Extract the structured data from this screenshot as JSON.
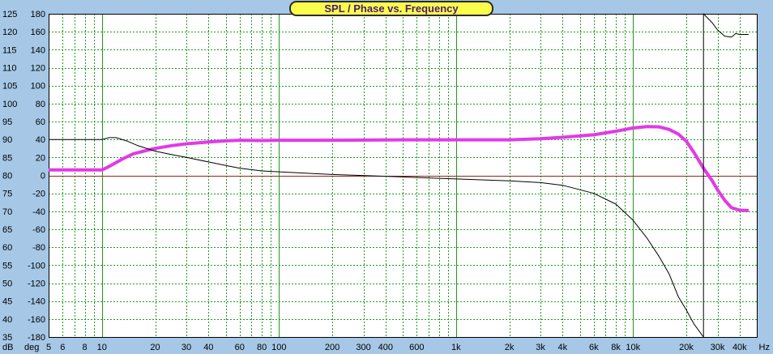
{
  "title": "SPL / Phase vs. Frequency",
  "colors": {
    "background": "#a6c8e6",
    "plot_area": "#ffffff",
    "grid": "#1f9a1f",
    "zero_line": "#8b2b1b",
    "spl_trace": "#e23ae6",
    "phase_trace": "#000000",
    "title_fill": "#fcfc4a",
    "title_text": "#4a1a7a"
  },
  "chart_data": {
    "type": "line",
    "title": "SPL / Phase vs. Frequency",
    "x_scale": "log",
    "xlim": [
      5,
      50000
    ],
    "x_unit_label": "Hz",
    "x_ticks": [
      {
        "v": 5,
        "label": "5"
      },
      {
        "v": 6,
        "label": "6"
      },
      {
        "v": 8,
        "label": "8"
      },
      {
        "v": 10,
        "label": "10"
      },
      {
        "v": 20,
        "label": "20"
      },
      {
        "v": 30,
        "label": "30"
      },
      {
        "v": 40,
        "label": "40"
      },
      {
        "v": 60,
        "label": "60"
      },
      {
        "v": 80,
        "label": "80"
      },
      {
        "v": 100,
        "label": "100"
      },
      {
        "v": 200,
        "label": "200"
      },
      {
        "v": 300,
        "label": "300"
      },
      {
        "v": 400,
        "label": "400"
      },
      {
        "v": 600,
        "label": "600"
      },
      {
        "v": 1000,
        "label": "1k"
      },
      {
        "v": 2000,
        "label": "2k"
      },
      {
        "v": 3000,
        "label": "3k"
      },
      {
        "v": 4000,
        "label": "4k"
      },
      {
        "v": 6000,
        "label": "6k"
      },
      {
        "v": 8000,
        "label": "8k"
      },
      {
        "v": 10000,
        "label": "10k"
      },
      {
        "v": 20000,
        "label": "20k"
      },
      {
        "v": 30000,
        "label": "30k"
      },
      {
        "v": 40000,
        "label": "40k"
      }
    ],
    "y_left": {
      "unit_label": "dB",
      "ylim": [
        35,
        125
      ],
      "ticks": [
        35,
        40,
        45,
        50,
        55,
        60,
        65,
        70,
        75,
        80,
        85,
        90,
        95,
        100,
        105,
        110,
        115,
        120,
        125
      ]
    },
    "y_right": {
      "unit_label": "deg",
      "ylim": [
        -180,
        180
      ],
      "ticks": [
        -180,
        -160,
        -140,
        -120,
        -100,
        -80,
        -60,
        -40,
        -20,
        0,
        20,
        40,
        60,
        80,
        100,
        120,
        140,
        160,
        180
      ]
    },
    "grid": true,
    "series": [
      {
        "axis": "left",
        "color": "#e23ae6",
        "points": [
          [
            5,
            81.5
          ],
          [
            10,
            81.5
          ],
          [
            11,
            82.5
          ],
          [
            13,
            84.5
          ],
          [
            15,
            86
          ],
          [
            18,
            87
          ],
          [
            20,
            87.5
          ],
          [
            25,
            88.3
          ],
          [
            30,
            88.8
          ],
          [
            40,
            89.3
          ],
          [
            50,
            89.6
          ],
          [
            60,
            89.8
          ],
          [
            80,
            89.7
          ],
          [
            100,
            89.8
          ],
          [
            200,
            89.8
          ],
          [
            500,
            89.9
          ],
          [
            1000,
            89.9
          ],
          [
            2000,
            89.9
          ],
          [
            3000,
            90.2
          ],
          [
            4000,
            90.6
          ],
          [
            6000,
            91.3
          ],
          [
            8000,
            92.3
          ],
          [
            10000,
            93.2
          ],
          [
            12000,
            93.6
          ],
          [
            14000,
            93.5
          ],
          [
            16000,
            92.8
          ],
          [
            18000,
            91.5
          ],
          [
            20000,
            89.5
          ],
          [
            22000,
            86.5
          ],
          [
            25000,
            82
          ],
          [
            28000,
            78.5
          ],
          [
            30000,
            76
          ],
          [
            33000,
            73
          ],
          [
            36000,
            71
          ],
          [
            40000,
            70.3
          ],
          [
            45000,
            70.2
          ]
        ]
      },
      {
        "axis": "right",
        "color": "#000000",
        "points": [
          [
            5,
            40
          ],
          [
            10,
            40
          ],
          [
            11,
            42
          ],
          [
            12,
            42
          ],
          [
            14,
            38
          ],
          [
            16,
            33
          ],
          [
            20,
            27
          ],
          [
            25,
            23
          ],
          [
            30,
            20
          ],
          [
            40,
            15
          ],
          [
            50,
            11
          ],
          [
            60,
            8
          ],
          [
            80,
            5
          ],
          [
            100,
            4
          ],
          [
            200,
            1
          ],
          [
            400,
            -1
          ],
          [
            1000,
            -4
          ],
          [
            2000,
            -6
          ],
          [
            3000,
            -8
          ],
          [
            4000,
            -11
          ],
          [
            6000,
            -20
          ],
          [
            8000,
            -32
          ],
          [
            10000,
            -50
          ],
          [
            12000,
            -70
          ],
          [
            14000,
            -90
          ],
          [
            16000,
            -110
          ],
          [
            18000,
            -135
          ],
          [
            20000,
            -150
          ],
          [
            22000,
            -165
          ],
          [
            25000,
            -180
          ],
          [
            25000,
            180
          ],
          [
            28000,
            170
          ],
          [
            30000,
            162
          ],
          [
            33000,
            155
          ],
          [
            36000,
            154
          ],
          [
            38000,
            158
          ],
          [
            40000,
            157
          ],
          [
            45000,
            157
          ]
        ]
      }
    ]
  }
}
